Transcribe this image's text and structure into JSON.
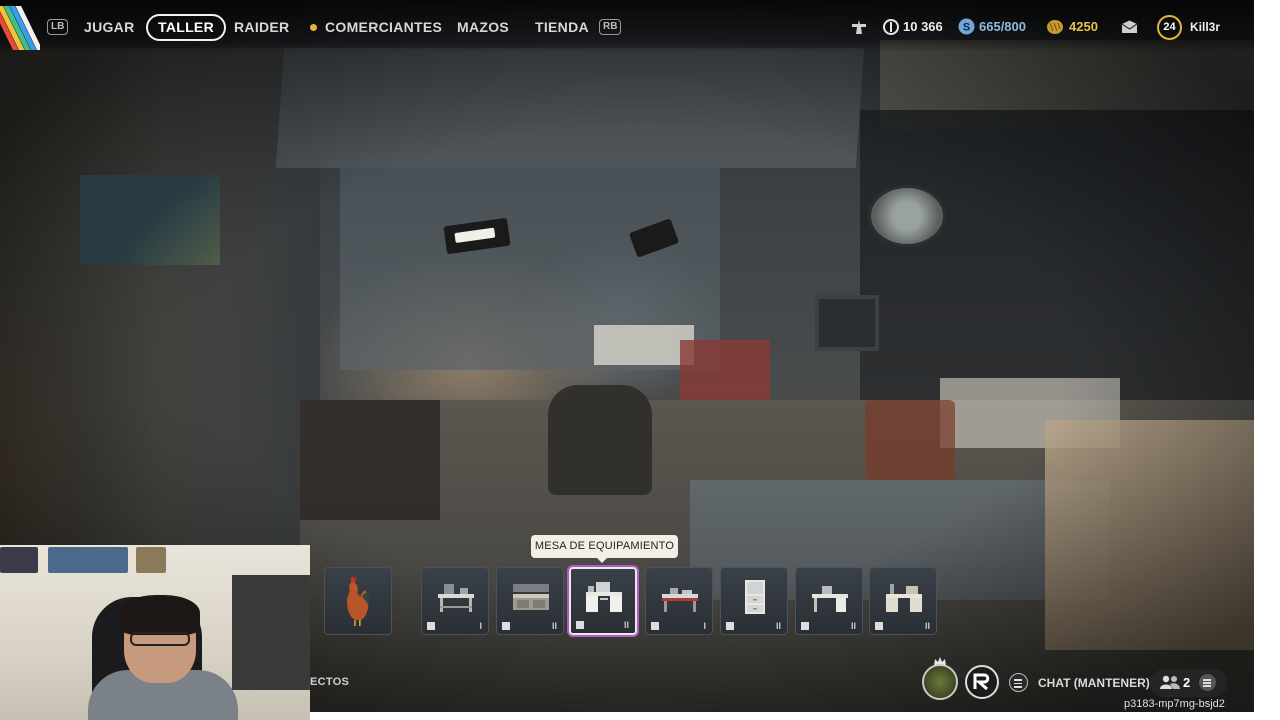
{
  "nav": {
    "left_bumper": "LB",
    "right_bumper": "RB",
    "items": [
      {
        "label": "JUGAR"
      },
      {
        "label": "TALLER",
        "active": true
      },
      {
        "label": "RAIDER"
      },
      {
        "label": "COMERCIANTES"
      },
      {
        "label": "MAZOS"
      },
      {
        "label": "TIENDA"
      }
    ]
  },
  "currencies": {
    "coins": "10 366",
    "tokens": "665/800",
    "gold": "4250"
  },
  "player": {
    "level": "24",
    "name": "Kill3r"
  },
  "workshop": {
    "tooltip": "MESA DE EQUIPAMIENTO",
    "selected_index": 3,
    "stations": [
      {
        "icon": "rooster-icon",
        "tier": ""
      },
      {
        "icon": "workbench-icon",
        "tier": "I"
      },
      {
        "icon": "workbench-icon",
        "tier": "II"
      },
      {
        "icon": "equipment-bench-icon",
        "tier": "II"
      },
      {
        "icon": "medical-bench-icon",
        "tier": "I"
      },
      {
        "icon": "cabinet-icon",
        "tier": "II"
      },
      {
        "icon": "utility-desk-icon",
        "tier": "II"
      },
      {
        "icon": "refiner-desk-icon",
        "tier": "II"
      }
    ]
  },
  "hud": {
    "partial_label": "ECTOS",
    "chat": "CHAT (MANTENER)",
    "party_count": "2",
    "session_id": "p3183-mp7mg-bsjd2"
  },
  "colors": {
    "accent_gold": "#e2b43a",
    "selection_purple": "#b05ac8",
    "token_blue": "#6ea7d8"
  }
}
